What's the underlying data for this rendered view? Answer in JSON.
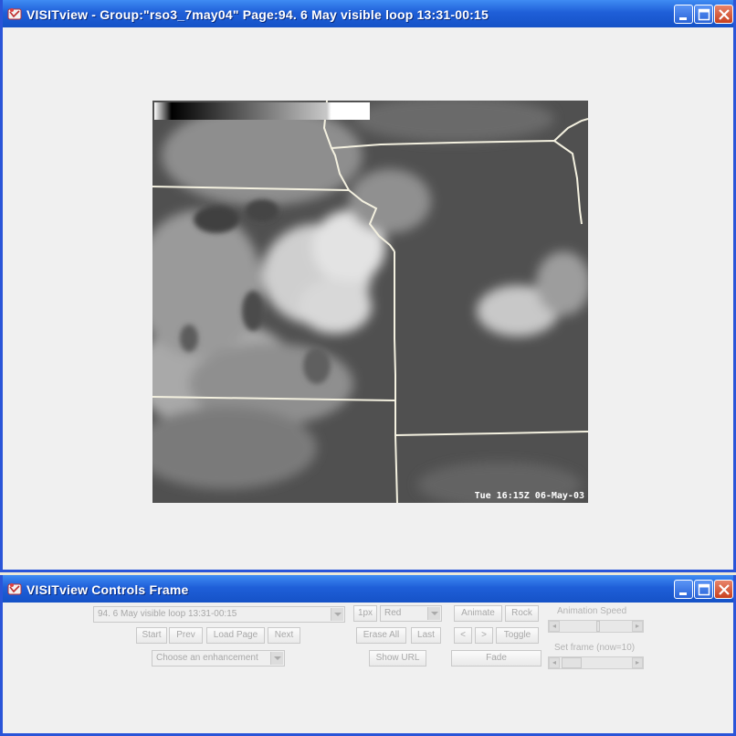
{
  "main_window": {
    "title": "VISITview - Group:\"rso3_7may04\"     Page:94. 6 May visible loop 13:31-00:15",
    "image_timestamp": "Tue 16:15Z 06-May-03"
  },
  "controls_window": {
    "title": "VISITview Controls Frame",
    "page_select": "94. 6 May visible loop 13:31-00:15",
    "start_label": "Start",
    "prev_label": "Prev",
    "load_page_label": "Load Page",
    "next_label": "Next",
    "enhancement_select": "Choose an enhancement",
    "line_width_label": "1px",
    "color_select": "Red",
    "erase_all_label": "Erase All",
    "last_label": "Last",
    "show_url_label": "Show URL",
    "animate_label": "Animate",
    "rock_label": "Rock",
    "step_back_label": "<",
    "step_forward_label": ">",
    "toggle_label": "Toggle",
    "fade_label": "Fade",
    "animation_speed_label": "Animation Speed",
    "set_frame_label": "Set frame (now=10)"
  },
  "colors": {
    "titlebar_blue": "#1f5fd8",
    "window_bg": "#f0f0f0",
    "close_red": "#c8401e"
  },
  "icons": [
    "app-icon",
    "minimize-icon",
    "maximize-icon",
    "close-icon"
  ]
}
